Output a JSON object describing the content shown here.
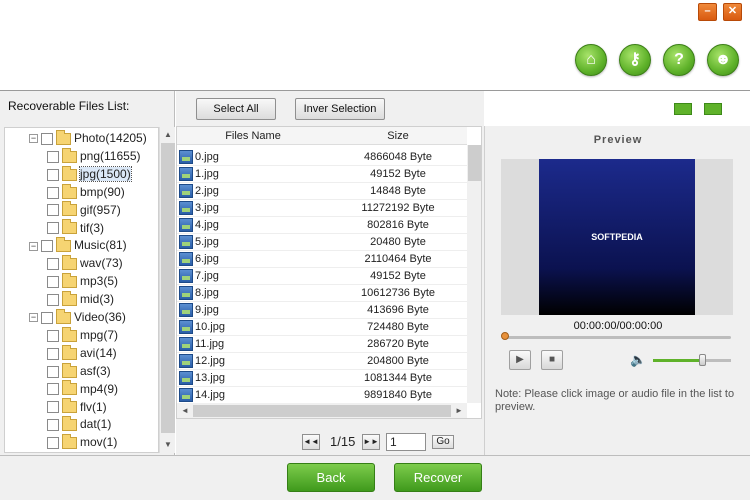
{
  "window": {
    "minimize_label": "–",
    "close_label": "✕"
  },
  "top_icons": [
    {
      "name": "home-icon",
      "glyph": "⌂"
    },
    {
      "name": "key-icon",
      "glyph": "⚷"
    },
    {
      "name": "help-icon",
      "glyph": "?"
    },
    {
      "name": "users-icon",
      "glyph": "☻"
    }
  ],
  "left": {
    "header": "Recoverable Files List:",
    "tree": [
      {
        "label": "Photo(14205)",
        "level": 0,
        "toggle": "−"
      },
      {
        "label": "png(11655)",
        "level": 1
      },
      {
        "label": "jpg(1500)",
        "level": 1,
        "selected": true
      },
      {
        "label": "bmp(90)",
        "level": 1
      },
      {
        "label": "gif(957)",
        "level": 1
      },
      {
        "label": "tif(3)",
        "level": 1
      },
      {
        "label": "Music(81)",
        "level": 0,
        "toggle": "−"
      },
      {
        "label": "wav(73)",
        "level": 1
      },
      {
        "label": "mp3(5)",
        "level": 1
      },
      {
        "label": "mid(3)",
        "level": 1
      },
      {
        "label": "Video(36)",
        "level": 0,
        "toggle": "−"
      },
      {
        "label": "mpg(7)",
        "level": 1
      },
      {
        "label": "avi(14)",
        "level": 1
      },
      {
        "label": "asf(3)",
        "level": 1
      },
      {
        "label": "mp4(9)",
        "level": 1
      },
      {
        "label": "flv(1)",
        "level": 1
      },
      {
        "label": "dat(1)",
        "level": 1
      },
      {
        "label": "mov(1)",
        "level": 1
      }
    ]
  },
  "toolbar": {
    "select_all": "Select All",
    "invert_selection": "Inver Selection"
  },
  "table": {
    "col_name": "Files Name",
    "col_size": "Size",
    "rows": [
      {
        "name": "0.jpg",
        "size": "4866048 Byte"
      },
      {
        "name": "1.jpg",
        "size": "49152 Byte"
      },
      {
        "name": "2.jpg",
        "size": "14848 Byte"
      },
      {
        "name": "3.jpg",
        "size": "11272192 Byte"
      },
      {
        "name": "4.jpg",
        "size": "802816 Byte"
      },
      {
        "name": "5.jpg",
        "size": "20480 Byte"
      },
      {
        "name": "6.jpg",
        "size": "2110464 Byte"
      },
      {
        "name": "7.jpg",
        "size": "49152 Byte"
      },
      {
        "name": "8.jpg",
        "size": "10612736 Byte"
      },
      {
        "name": "9.jpg",
        "size": "413696 Byte"
      },
      {
        "name": "10.jpg",
        "size": "724480 Byte"
      },
      {
        "name": "11.jpg",
        "size": "286720 Byte"
      },
      {
        "name": "12.jpg",
        "size": "204800 Byte"
      },
      {
        "name": "13.jpg",
        "size": "1081344 Byte"
      },
      {
        "name": "14.jpg",
        "size": "9891840 Byte"
      }
    ]
  },
  "pager": {
    "text": "1/15",
    "input_value": "1",
    "go_label": "Go",
    "prev": "◄◄",
    "next": "►►"
  },
  "preview": {
    "title": "Preview",
    "image_text": "SOFTPEDIA",
    "time": "00:00:00/00:00:00",
    "play": "▶",
    "stop": "■",
    "volume_icon": "🔈",
    "volume_level": 0.62,
    "note": "Note: Please click image or audio file in the list to preview."
  },
  "footer": {
    "back": "Back",
    "recover": "Recover"
  }
}
